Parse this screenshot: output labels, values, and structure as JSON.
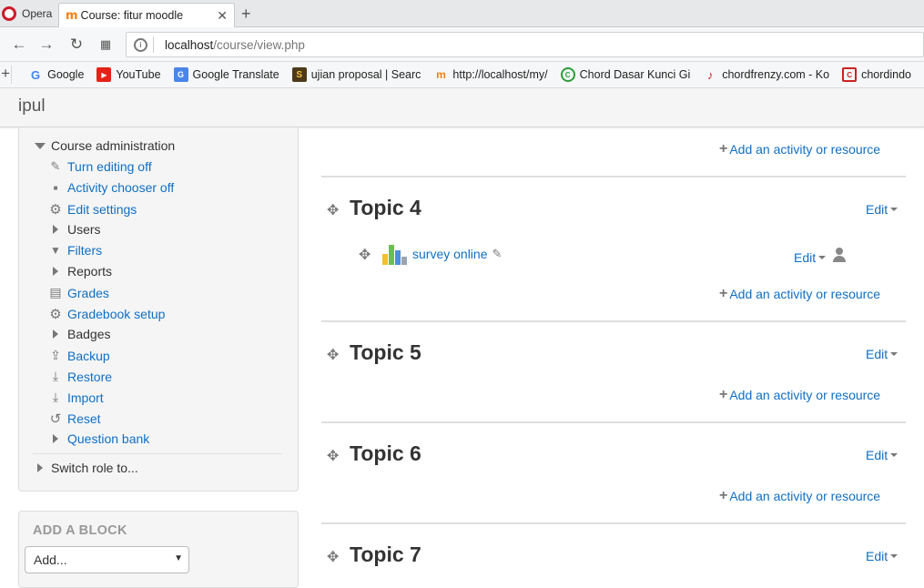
{
  "browser": {
    "opera_label": "Opera",
    "tab_title": "Course: fitur moodle",
    "url_host": "localhost",
    "url_path": "/course/view.php",
    "bookmarks": [
      {
        "label": "Google",
        "icon": "google-icon"
      },
      {
        "label": "YouTube",
        "icon": "youtube-icon"
      },
      {
        "label": "Google Translate",
        "icon": "translate-icon"
      },
      {
        "label": "ujian proposal | Searc",
        "icon": "bookmark-s-icon"
      },
      {
        "label": "http://localhost/my/",
        "icon": "moodle-icon"
      },
      {
        "label": "Chord Dasar Kunci Gi",
        "icon": "chord-icon"
      },
      {
        "label": "chordfrenzy.com - Ko",
        "icon": "guitar-icon"
      },
      {
        "label": "chordindo",
        "icon": "chordindo-icon"
      }
    ]
  },
  "header": {
    "site_name": "ipul"
  },
  "sidebar": {
    "course_admin_label": "Course administration",
    "items": [
      {
        "label": "Turn editing off",
        "link": true,
        "icon": "pencil-icon"
      },
      {
        "label": "Activity chooser off",
        "link": true,
        "icon": "square-bullet-icon"
      },
      {
        "label": "Edit settings",
        "link": true,
        "icon": "gear-icon"
      },
      {
        "label": "Users",
        "link": false,
        "icon": "expand-arrow-icon"
      },
      {
        "label": "Filters",
        "link": true,
        "icon": "filter-icon"
      },
      {
        "label": "Reports",
        "link": false,
        "icon": "expand-arrow-icon"
      },
      {
        "label": "Grades",
        "link": true,
        "icon": "grades-table-icon"
      },
      {
        "label": "Gradebook setup",
        "link": true,
        "icon": "gear-icon"
      },
      {
        "label": "Badges",
        "link": false,
        "icon": "expand-arrow-icon"
      },
      {
        "label": "Backup",
        "link": true,
        "icon": "upload-icon"
      },
      {
        "label": "Restore",
        "link": true,
        "icon": "download-icon"
      },
      {
        "label": "Import",
        "link": true,
        "icon": "import-icon"
      },
      {
        "label": "Reset",
        "link": true,
        "icon": "reset-icon"
      },
      {
        "label": "Question bank",
        "link": true,
        "icon": "expand-arrow-icon"
      }
    ],
    "switch_role_label": "Switch role to...",
    "add_block_title": "ADD A BLOCK",
    "add_block_select": "Add..."
  },
  "main": {
    "add_activity_label": "Add an activity or resource",
    "edit_label": "Edit",
    "topics": [
      {
        "title": "Topic 4"
      },
      {
        "title": "Topic 5"
      },
      {
        "title": "Topic 6"
      },
      {
        "title": "Topic 7"
      }
    ],
    "activity": {
      "name": "survey online",
      "edit_label": "Edit"
    }
  },
  "colors": {
    "link": "#0f6fc5",
    "muted": "#777777"
  }
}
